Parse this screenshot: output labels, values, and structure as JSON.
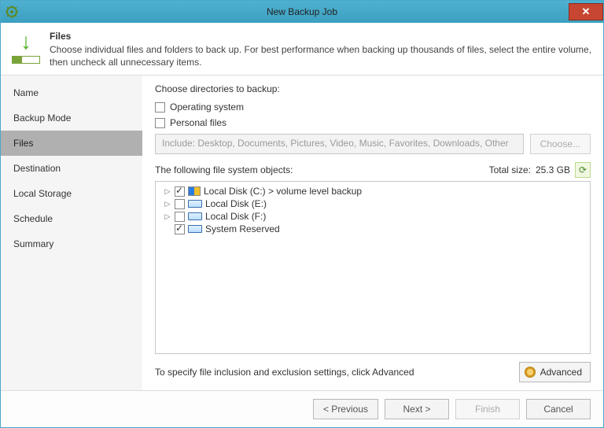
{
  "window": {
    "title": "New Backup Job",
    "close_glyph": "✕"
  },
  "header": {
    "title": "Files",
    "desc": "Choose individual files and folders to back up. For best performance when backing up thousands of files, select the entire volume, then uncheck all unnecessary items."
  },
  "sidebar": {
    "items": [
      {
        "label": "Name"
      },
      {
        "label": "Backup Mode"
      },
      {
        "label": "Files"
      },
      {
        "label": "Destination"
      },
      {
        "label": "Local Storage"
      },
      {
        "label": "Schedule"
      },
      {
        "label": "Summary"
      }
    ],
    "activeIndex": 2
  },
  "main": {
    "choose_label": "Choose directories to backup:",
    "os_label": "Operating system",
    "personal_label": "Personal files",
    "include_placeholder": "Include: Desktop, Documents, Pictures, Video, Music, Favorites, Downloads, Other",
    "choose_btn": "Choose...",
    "objects_label": "The following file system objects:",
    "total_label": "Total size:",
    "total_value": "25.3 GB",
    "tree": [
      {
        "label": "Local Disk (C:) > volume level backup",
        "checked": true,
        "expandable": true,
        "icon": "c"
      },
      {
        "label": "Local Disk (E:)",
        "checked": false,
        "expandable": true,
        "icon": "disk"
      },
      {
        "label": "Local Disk (F:)",
        "checked": false,
        "expandable": true,
        "icon": "disk"
      },
      {
        "label": "System Reserved",
        "checked": true,
        "expandable": false,
        "icon": "disk"
      }
    ],
    "hint": "To specify file inclusion and exclusion settings, click Advanced",
    "advanced_btn": "Advanced"
  },
  "footer": {
    "prev": "< Previous",
    "next": "Next >",
    "finish": "Finish",
    "cancel": "Cancel"
  }
}
